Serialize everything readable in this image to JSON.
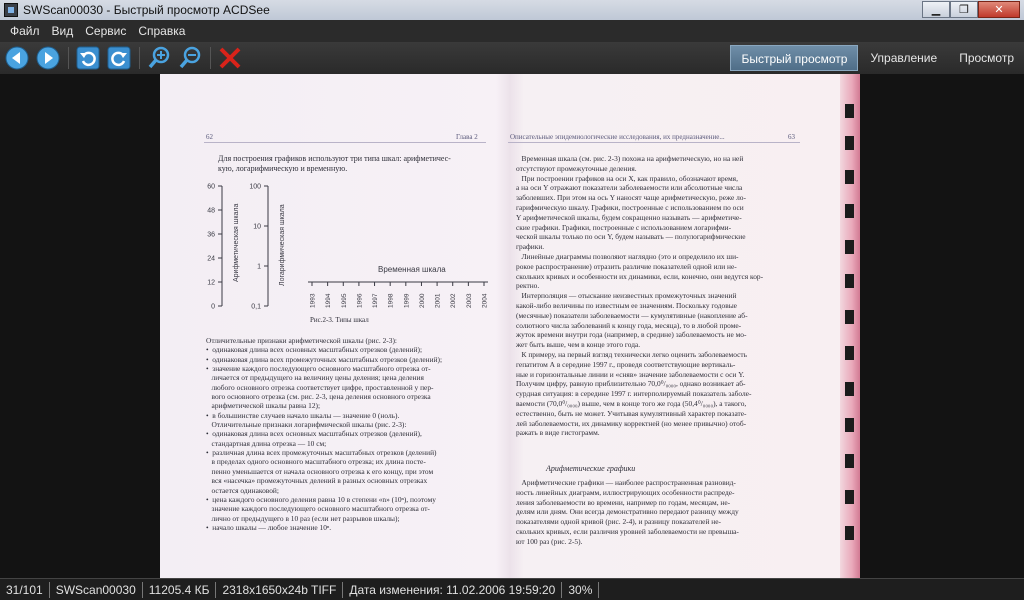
{
  "window": {
    "title": "SWScan00030 - Быстрый просмотр ACDSee"
  },
  "menu": [
    "Файл",
    "Вид",
    "Сервис",
    "Справка"
  ],
  "toolbar": {
    "icons": [
      "arrow-left-icon",
      "arrow-right-icon",
      "rotate-left-icon",
      "rotate-right-icon",
      "zoom-in-icon",
      "zoom-out-icon",
      "delete-icon"
    ]
  },
  "modes": {
    "quick_view": "Быстрый просмотр",
    "manage": "Управление",
    "view": "Просмотр"
  },
  "scan": {
    "left_page_number": "62",
    "left_header": "Глава 2",
    "right_header": "Описательные эпидемиологические исследования, их предназначение...",
    "right_page_number": "63",
    "left_intro": "Для построения графиков используют три типа шкал: арифметичес-\nкую, логарифмическую и временную.",
    "figure_caption": "Рис.2-3.  Типы шкал",
    "arith_label": "Арифметическая шкала",
    "log_label": "Логарифмическая шкала",
    "time_label": "Временная шкала",
    "arith_ticks": [
      "60",
      "48",
      "36",
      "24",
      "12",
      "0"
    ],
    "log_ticks": [
      "100",
      "10",
      "1",
      "0,1"
    ],
    "time_ticks": [
      "1993",
      "1994",
      "1995",
      "1996",
      "1997",
      "1998",
      "1999",
      "2000",
      "2001",
      "2002",
      "2003",
      "2004"
    ],
    "left_body": "Отличительные признаки арифметической шкалы (рис. 2-3):\n•  одинаковая длина всех основных масштабных отрезков (делений);\n•  одинаковая длина всех промежуточных масштабных отрезков (делений);\n•  значение каждого последующего основного масштабного отрезка от-\n   личается от предыдущего на величину цены деления; цена деления\n   любого основного отрезка соответствует цифре, проставленной у пер-\n   вого основного отрезка (см. рис. 2-3, цена деления основного отрезка\n   арифметической шкалы равна 12);\n•  в большинстве случаев начало шкалы — значение 0 (ноль).\n   Отличительные признаки логарифмической шкалы (рис. 2-3):\n•  одинаковая длина всех основных масштабных отрезков (делений),\n   стандартная длина отрезка — 10 см;\n•  различная длина всех промежуточных масштабных отрезков (делений)\n   в пределах одного основного масштабного отрезка; их длина посте-\n   пенно уменьшается от начала основного отрезка к его концу, при этом\n   вся «насечка» промежуточных делений в разных основных отрезках\n   остается одинаковой;\n•  цена каждого основного деления равна 10 в степени «n» (10ⁿ), поэтому\n   значение каждого последующего основного масштабного отрезка от-\n   лично от предыдущего в 10 раз (если нет разрывов шкалы);\n•  начало шкалы — любое значение 10ⁿ.",
    "right_body": "   Временная шкала (см. рис. 2-3) похожа на арифметическую, но на ней\nотсутствуют промежуточные деления.\n   При построении графиков на оси X, как правило, обозначают время,\nа на оси Y отражают показатели заболеваемости или абсолютные числа\nзаболевших. При этом на ось Y наносят чаще арифметическую, реже ло-\nгарифмическую шкалу. Графики, построенные с использованием по оси\nY арифметической шкалы, будем сокращенно называть — арифметиче-\nские графики. Графики, построенные с использованием логарифми-\nческой шкалы только по оси Y, будем называть — полулогарифмические\nграфики.\n   Линейные диаграммы позволяют наглядно (это и определило их ши-\nрокое распространение) отразить различие показателей одной или не-\nскольких кривых и особенности их динамики, если, конечно, они ведутся кор-\nректно.\n   Интерполяция — отыскание неизвестных промежуточных значений\nкакой-либо величины по известным ее значениям. Поскольку годовые\n(месячные) показатели заболеваемости — кумулятивные (накопление аб-\nсолютного числа заболеваний к концу года, месяца), то в любой проме-\nжуток времени внутри года (например, в средине) заболеваемость не мо-\nжет быть выше, чем в конце этого года.\n   К примеру, на первый взгляд технически легко оценить заболеваемость\nгепатитом А в середине 1997 г., проведя соответствующие вертикаль-\nные и горизонтальные линии и «сняв» значение заболеваемости с оси Y.\nПолучим цифру, равную приблизительно 70,0⁰/₀₀₀₀, однако возникает аб-\nсурдная ситуация: в середине 1997 г. интерполируемый показатель заболе-\nваемости (70,0⁰/₀₀₀₀) выше, чем в конце того же года (50,4⁰/₀₀₀₀), а такого,\nестественно, быть не может. Учитывая кумулятивный характер показате-\nлей заболеваемости, их динамику корректней (но менее привычно) отоб-\nражать в виде гистограмм.",
    "right_subheading": "Арифметические графики",
    "right_body2": "   Арифметические графики — наиболее распространенная разновид-\nность линейных диаграмм, иллюстрирующих особенности распреде-\nления заболеваемости во времени, например по годам, месяцам, не-\nделям или дням. Они всегда демонстративно передают разницу между\nпоказателями одной кривой (рис. 2-4), и разницу показателей не-\nскольких кривых, если различия уровней заболеваемости не превыша-\nют 100 раз (рис. 2-5)."
  },
  "status": {
    "index": "31/101",
    "filename": "SWScan00030",
    "size": "11205.4 КБ",
    "dims": "2318x1650x24b TIFF",
    "modified": "Дата изменения: 11.02.2006 19:59:20",
    "zoom": "30%"
  },
  "colors": {
    "active_tab": "#5b7b95",
    "delete_red": "#d9231a",
    "nav_blue": "#4aa3e0"
  }
}
